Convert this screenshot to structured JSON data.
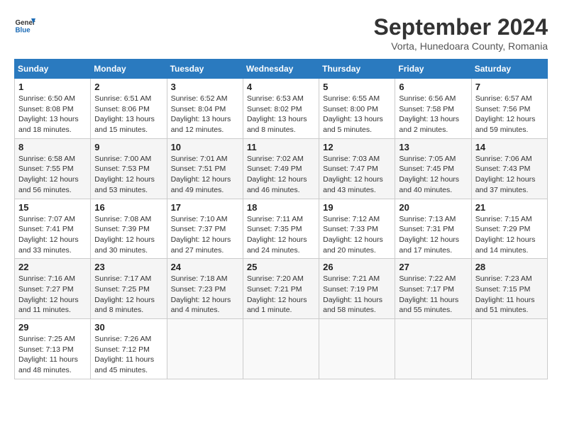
{
  "header": {
    "logo_general": "General",
    "logo_blue": "Blue",
    "title": "September 2024",
    "subtitle": "Vorta, Hunedoara County, Romania"
  },
  "weekdays": [
    "Sunday",
    "Monday",
    "Tuesday",
    "Wednesday",
    "Thursday",
    "Friday",
    "Saturday"
  ],
  "weeks": [
    [
      {
        "day": "1",
        "sunrise": "Sunrise: 6:50 AM",
        "sunset": "Sunset: 8:08 PM",
        "daylight": "Daylight: 13 hours and 18 minutes."
      },
      {
        "day": "2",
        "sunrise": "Sunrise: 6:51 AM",
        "sunset": "Sunset: 8:06 PM",
        "daylight": "Daylight: 13 hours and 15 minutes."
      },
      {
        "day": "3",
        "sunrise": "Sunrise: 6:52 AM",
        "sunset": "Sunset: 8:04 PM",
        "daylight": "Daylight: 13 hours and 12 minutes."
      },
      {
        "day": "4",
        "sunrise": "Sunrise: 6:53 AM",
        "sunset": "Sunset: 8:02 PM",
        "daylight": "Daylight: 13 hours and 8 minutes."
      },
      {
        "day": "5",
        "sunrise": "Sunrise: 6:55 AM",
        "sunset": "Sunset: 8:00 PM",
        "daylight": "Daylight: 13 hours and 5 minutes."
      },
      {
        "day": "6",
        "sunrise": "Sunrise: 6:56 AM",
        "sunset": "Sunset: 7:58 PM",
        "daylight": "Daylight: 13 hours and 2 minutes."
      },
      {
        "day": "7",
        "sunrise": "Sunrise: 6:57 AM",
        "sunset": "Sunset: 7:56 PM",
        "daylight": "Daylight: 12 hours and 59 minutes."
      }
    ],
    [
      {
        "day": "8",
        "sunrise": "Sunrise: 6:58 AM",
        "sunset": "Sunset: 7:55 PM",
        "daylight": "Daylight: 12 hours and 56 minutes."
      },
      {
        "day": "9",
        "sunrise": "Sunrise: 7:00 AM",
        "sunset": "Sunset: 7:53 PM",
        "daylight": "Daylight: 12 hours and 53 minutes."
      },
      {
        "day": "10",
        "sunrise": "Sunrise: 7:01 AM",
        "sunset": "Sunset: 7:51 PM",
        "daylight": "Daylight: 12 hours and 49 minutes."
      },
      {
        "day": "11",
        "sunrise": "Sunrise: 7:02 AM",
        "sunset": "Sunset: 7:49 PM",
        "daylight": "Daylight: 12 hours and 46 minutes."
      },
      {
        "day": "12",
        "sunrise": "Sunrise: 7:03 AM",
        "sunset": "Sunset: 7:47 PM",
        "daylight": "Daylight: 12 hours and 43 minutes."
      },
      {
        "day": "13",
        "sunrise": "Sunrise: 7:05 AM",
        "sunset": "Sunset: 7:45 PM",
        "daylight": "Daylight: 12 hours and 40 minutes."
      },
      {
        "day": "14",
        "sunrise": "Sunrise: 7:06 AM",
        "sunset": "Sunset: 7:43 PM",
        "daylight": "Daylight: 12 hours and 37 minutes."
      }
    ],
    [
      {
        "day": "15",
        "sunrise": "Sunrise: 7:07 AM",
        "sunset": "Sunset: 7:41 PM",
        "daylight": "Daylight: 12 hours and 33 minutes."
      },
      {
        "day": "16",
        "sunrise": "Sunrise: 7:08 AM",
        "sunset": "Sunset: 7:39 PM",
        "daylight": "Daylight: 12 hours and 30 minutes."
      },
      {
        "day": "17",
        "sunrise": "Sunrise: 7:10 AM",
        "sunset": "Sunset: 7:37 PM",
        "daylight": "Daylight: 12 hours and 27 minutes."
      },
      {
        "day": "18",
        "sunrise": "Sunrise: 7:11 AM",
        "sunset": "Sunset: 7:35 PM",
        "daylight": "Daylight: 12 hours and 24 minutes."
      },
      {
        "day": "19",
        "sunrise": "Sunrise: 7:12 AM",
        "sunset": "Sunset: 7:33 PM",
        "daylight": "Daylight: 12 hours and 20 minutes."
      },
      {
        "day": "20",
        "sunrise": "Sunrise: 7:13 AM",
        "sunset": "Sunset: 7:31 PM",
        "daylight": "Daylight: 12 hours and 17 minutes."
      },
      {
        "day": "21",
        "sunrise": "Sunrise: 7:15 AM",
        "sunset": "Sunset: 7:29 PM",
        "daylight": "Daylight: 12 hours and 14 minutes."
      }
    ],
    [
      {
        "day": "22",
        "sunrise": "Sunrise: 7:16 AM",
        "sunset": "Sunset: 7:27 PM",
        "daylight": "Daylight: 12 hours and 11 minutes."
      },
      {
        "day": "23",
        "sunrise": "Sunrise: 7:17 AM",
        "sunset": "Sunset: 7:25 PM",
        "daylight": "Daylight: 12 hours and 8 minutes."
      },
      {
        "day": "24",
        "sunrise": "Sunrise: 7:18 AM",
        "sunset": "Sunset: 7:23 PM",
        "daylight": "Daylight: 12 hours and 4 minutes."
      },
      {
        "day": "25",
        "sunrise": "Sunrise: 7:20 AM",
        "sunset": "Sunset: 7:21 PM",
        "daylight": "Daylight: 12 hours and 1 minute."
      },
      {
        "day": "26",
        "sunrise": "Sunrise: 7:21 AM",
        "sunset": "Sunset: 7:19 PM",
        "daylight": "Daylight: 11 hours and 58 minutes."
      },
      {
        "day": "27",
        "sunrise": "Sunrise: 7:22 AM",
        "sunset": "Sunset: 7:17 PM",
        "daylight": "Daylight: 11 hours and 55 minutes."
      },
      {
        "day": "28",
        "sunrise": "Sunrise: 7:23 AM",
        "sunset": "Sunset: 7:15 PM",
        "daylight": "Daylight: 11 hours and 51 minutes."
      }
    ],
    [
      {
        "day": "29",
        "sunrise": "Sunrise: 7:25 AM",
        "sunset": "Sunset: 7:13 PM",
        "daylight": "Daylight: 11 hours and 48 minutes."
      },
      {
        "day": "30",
        "sunrise": "Sunrise: 7:26 AM",
        "sunset": "Sunset: 7:12 PM",
        "daylight": "Daylight: 11 hours and 45 minutes."
      },
      null,
      null,
      null,
      null,
      null
    ]
  ]
}
